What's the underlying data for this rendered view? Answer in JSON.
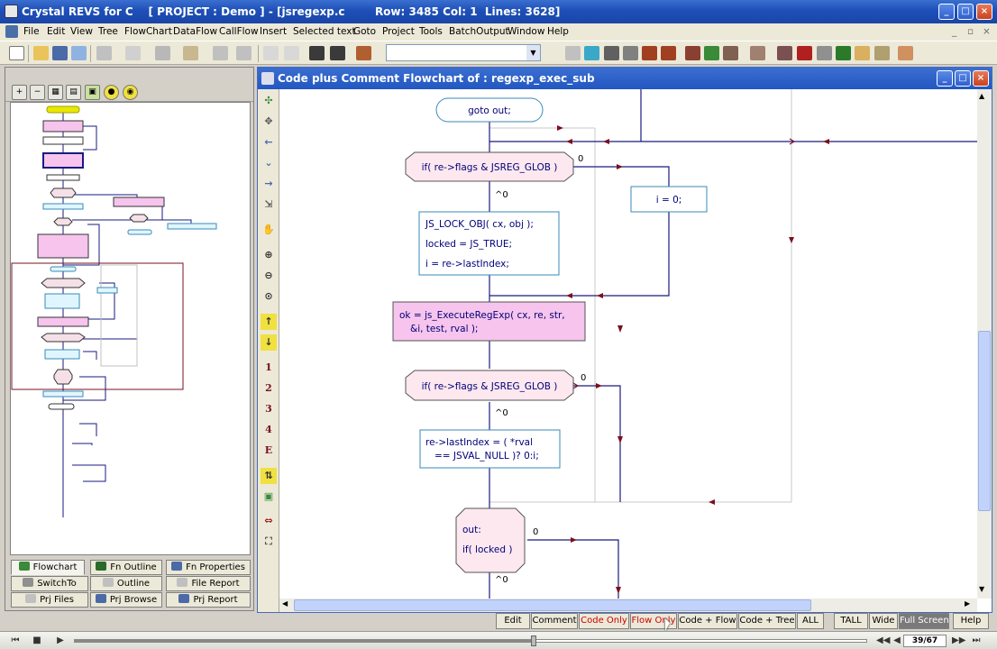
{
  "window": {
    "title": "Crystal REVS for C    [ PROJECT : Demo ] - [jsregexp.c        Row: 3485 Col: 1  Lines: 3628]",
    "controls": [
      "_",
      "□",
      "×"
    ]
  },
  "menu": {
    "items": [
      "File",
      "Edit",
      "View",
      "Tree",
      "FlowChart",
      "DataFlow",
      "CallFlow",
      "Insert",
      "Selected text",
      "Goto",
      "Project",
      "Tools",
      "BatchOutput",
      "Window",
      "Help"
    ],
    "mdi_controls": [
      "_",
      "▫",
      "×"
    ]
  },
  "toolbar": {
    "combo_value": ""
  },
  "left_tabs": {
    "row1": [
      "Flowchart",
      "Fn Outline",
      "Fn Properties"
    ],
    "row2": [
      "SwitchTo",
      "Outline",
      "File Report"
    ],
    "row3": [
      "Prj Files",
      "Prj Browse",
      "Prj Report"
    ]
  },
  "flowchart_window": {
    "title": "Code plus Comment Flowchart of : regexp_exec_sub",
    "controls": [
      "_",
      "□",
      "×"
    ],
    "vtool_labels": [
      "1",
      "2",
      "3",
      "4",
      "E"
    ]
  },
  "flowchart": {
    "goto_out": "goto out;",
    "cond1": "if( re->flags & JSREG_GLOB )",
    "cond1_true": "0",
    "cond1_false": "^0",
    "assign_i": "i = 0;",
    "lock_lines": [
      "JS_LOCK_OBJ( cx, obj );",
      "locked = JS_TRUE;",
      "i = re->lastIndex;"
    ],
    "exec_lines": [
      "ok = js_ExecuteRegExp( cx, re, str,",
      "&i, test, rval );"
    ],
    "cond2": "if( re->flags & JSREG_GLOB )",
    "cond2_true": "0",
    "cond2_false": "^0",
    "lastindex_lines": [
      "re->lastIndex = ( *rval",
      "== JSVAL_NULL )? 0:i;"
    ],
    "out_lines": [
      "out:",
      "if( locked )"
    ],
    "cond3_true": "0",
    "cond3_false": "^0"
  },
  "bottom_buttons": [
    "Edit",
    "Comment",
    "Code Only",
    "Flow Only",
    "Code + Flow",
    "Code + Tree",
    "ALL",
    "TALL",
    "Wide",
    "Full Screen",
    "Help"
  ],
  "player": {
    "page": "39/67",
    "progress": 0.58
  },
  "colors": {
    "title_blue": "#2357c2",
    "flow_line": "#1a1a80",
    "arrow": "#7a1020",
    "action_fill": "#f6c4ec",
    "comment_fill": "#ffffff",
    "highlight_red": "#cc0000"
  }
}
